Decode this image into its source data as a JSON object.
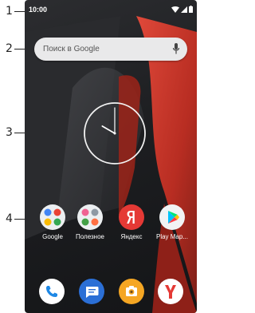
{
  "annotations": {
    "items": [
      "1",
      "2",
      "3",
      "4"
    ]
  },
  "status_bar": {
    "time": "10:00",
    "icons": [
      "wifi-icon",
      "signal-icon",
      "battery-icon"
    ]
  },
  "search": {
    "placeholder": "Поиск в Google",
    "icon": "mic-icon"
  },
  "clock_widget": {
    "type": "analog",
    "hour": 10,
    "minute": 0
  },
  "apps": [
    {
      "label": "Google",
      "icon": "google-folder-icon"
    },
    {
      "label": "Полезное",
      "icon": "useful-folder-icon"
    },
    {
      "label": "Яндекс",
      "icon": "yandex-icon"
    },
    {
      "label": "Play Map...",
      "icon": "play-market-icon"
    }
  ],
  "dock": [
    {
      "icon": "phone-icon"
    },
    {
      "icon": "messages-icon"
    },
    {
      "icon": "camera-icon"
    },
    {
      "icon": "yandex-browser-icon"
    }
  ],
  "colors": {
    "wallpaper_dark": "#1d1e21",
    "wallpaper_red": "#c7382c",
    "search_bg": "#e9e9ea",
    "yandex_red": "#e53935",
    "phone_blue": "#1e88e5",
    "messages_blue": "#2b6fd6",
    "camera_orange": "#f5a623"
  }
}
